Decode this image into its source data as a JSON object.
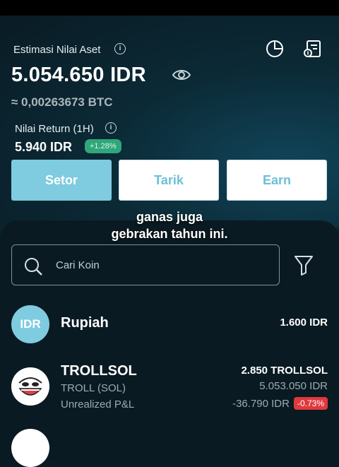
{
  "portfolio": {
    "estimate_label": "Estimasi Nilai Aset",
    "info_glyph": "i",
    "total_value": "5.054.650 IDR",
    "btc_value": "≈ 0,00263673 BTC",
    "return_label": "Nilai Return (1H)",
    "return_value": "5.940 IDR",
    "return_change": "+1.28%"
  },
  "icons": {
    "eye": "eye-icon",
    "pie": "pie-chart-icon",
    "report": "report-icon",
    "search": "search-icon",
    "filter": "filter-icon"
  },
  "actions": {
    "setor": "Setor",
    "tarik": "Tarik",
    "earn": "Earn"
  },
  "caption": {
    "line1": "ganas juga",
    "line2": "gebrakan tahun ini."
  },
  "search": {
    "placeholder": "Cari Koin"
  },
  "coins": [
    {
      "logo_text": "IDR",
      "name": "Rupiah",
      "amount": "1.600 IDR"
    },
    {
      "name": "TROLLSOL",
      "ticker": "TROLL (SOL)",
      "pnl_label": "Unrealized P&L",
      "amount": "2.850 TROLLSOL",
      "value_idr": "5.053.050 IDR",
      "pnl_value": "-36.790 IDR",
      "pnl_percent": "-0.73%"
    }
  ],
  "colors": {
    "accent": "#7fcbe0",
    "positive": "#2fa77a",
    "negative": "#e0393e",
    "background": "#0a1a22"
  }
}
